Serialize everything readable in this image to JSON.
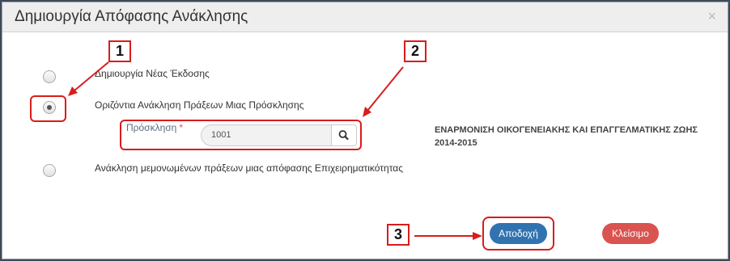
{
  "dialog": {
    "title": "Δημιουργία Απόφασης Ανάκλησης",
    "close_glyph": "×"
  },
  "options": [
    {
      "label": "Δημιουργία Νέας Έκδοσης",
      "selected": false
    },
    {
      "label": "Οριζόντια Ανάκληση Πράξεων Μιας Πρόσκλησης",
      "selected": true
    },
    {
      "label": "Ανάκληση μεμονωμένων πράξεων μιας απόφασης Επιχειρηματικότητας",
      "selected": false
    }
  ],
  "invitation": {
    "label": "Πρόσκληση",
    "required_mark": "*",
    "value": "1001",
    "description": "ΕΝΑΡΜΟΝΙΣΗ ΟΙΚΟΓΕΝΕΙΑΚΗΣ ΚΑΙ ΕΠΑΓΓΕΛΜΑΤΙΚΗΣ ΖΩΗΣ 2014-2015"
  },
  "buttons": {
    "accept": "Αποδοχή",
    "close": "Κλείσιμο"
  },
  "annotations": [
    "1",
    "2",
    "3"
  ],
  "colors": {
    "accept": "#3173b0",
    "close": "#d9534f",
    "annotation": "#d91c1c"
  },
  "icons": {
    "search": "search-icon",
    "close": "close-icon"
  }
}
